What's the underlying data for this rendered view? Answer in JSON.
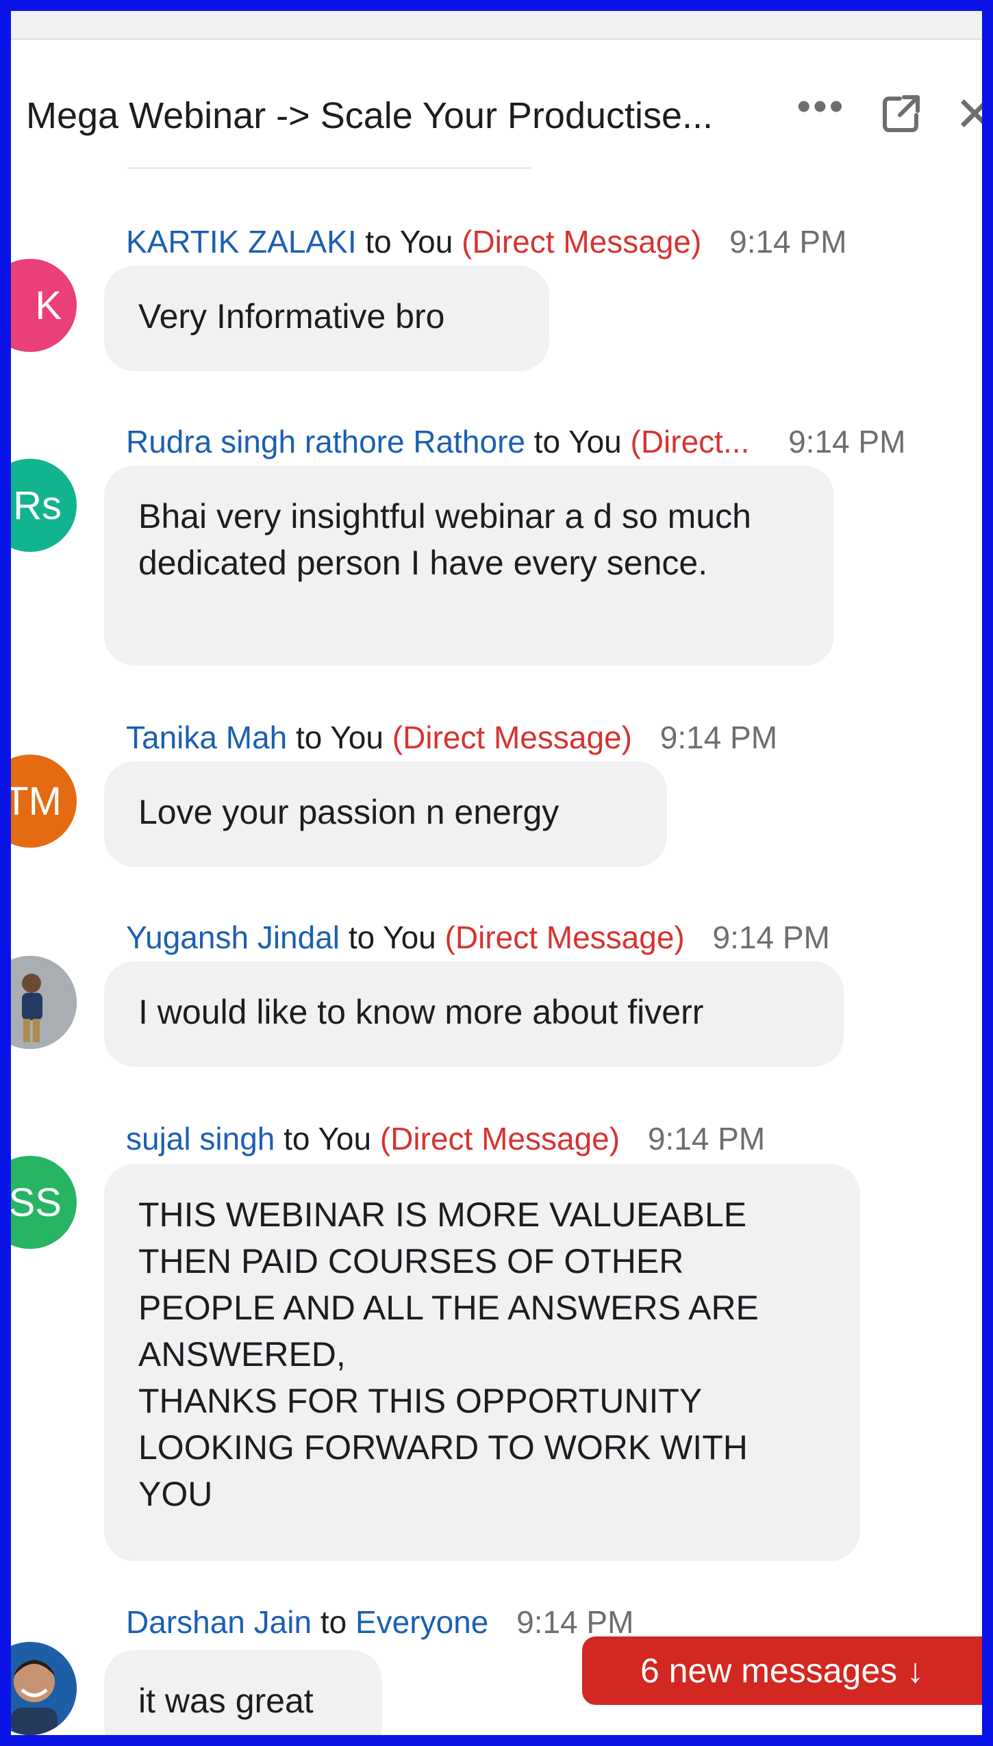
{
  "window": {
    "title": "Mega Webinar -> Scale Your Productise...",
    "more_icon": "more-icon",
    "popout_icon": "popout-icon",
    "close_icon": "close-icon"
  },
  "messages": [
    {
      "sender": "KARTIK ZALAKI",
      "to_word": "to",
      "recipient": "You",
      "tag": "(Direct Message)",
      "time": "9:14 PM",
      "text": "Very Informative bro",
      "avatar": "K",
      "avatar_color": "#ea3f78"
    },
    {
      "sender": "Rudra singh rathore Rathore",
      "to_word": "to",
      "recipient": "You",
      "tag": "(Direct...",
      "time": "9:14 PM",
      "text": "Bhai very insightful webinar a d so much dedicated person I have every sence.",
      "avatar": "Rs",
      "avatar_color": "#12b38f"
    },
    {
      "sender": "Tanika Mah",
      "to_word": "to",
      "recipient": "You",
      "tag": "(Direct Message)",
      "time": "9:14 PM",
      "text": "Love your passion n energy",
      "avatar": "TM",
      "avatar_color": "#e56b12"
    },
    {
      "sender": "Yugansh Jindal",
      "to_word": "to",
      "recipient": "You",
      "tag": "(Direct Message)",
      "time": "9:14 PM",
      "text": "I would like to know more about fiverr",
      "avatar_icon": "user-photo"
    },
    {
      "sender": "sujal singh",
      "to_word": "to",
      "recipient": "You",
      "tag": "(Direct Message)",
      "time": "9:14 PM",
      "text": "THIS WEBINAR IS MORE VALUEABLE THEN PAID COURSES OF OTHER PEOPLE AND ALL THE ANSWERS ARE ANSWERED,\nTHANKS FOR THIS OPPORTUNITY LOOKING FORWARD TO WORK WITH YOU",
      "avatar": "SS",
      "avatar_color": "#27b564"
    },
    {
      "sender": "Darshan Jain",
      "to_word": "to",
      "recipient": "Everyone",
      "tag": "",
      "time": "9:14 PM",
      "text": "it was great",
      "avatar_icon": "user-photo"
    }
  ],
  "new_messages": {
    "label": "6 new messages ↓",
    "color": "#d32722"
  }
}
